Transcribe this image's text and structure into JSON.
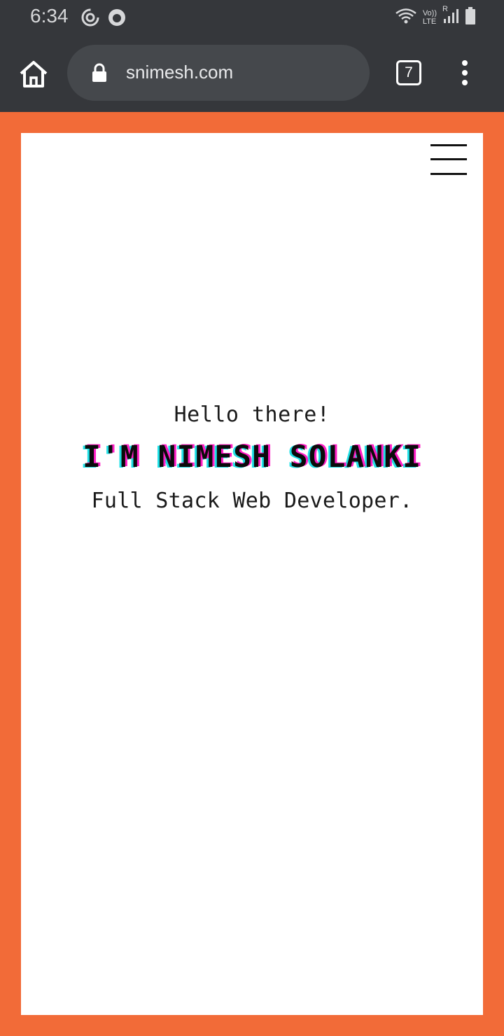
{
  "status_bar": {
    "time": "6:34",
    "network_label_top": "Vo))",
    "network_label_bottom": "LTE",
    "roaming": "R"
  },
  "browser": {
    "url": "snimesh.com",
    "tab_count": "7",
    "icons": [
      "home-icon",
      "lock-icon",
      "more-vert-icon"
    ]
  },
  "hero": {
    "greeting": "Hello there!",
    "name": "I'M NIMESH SOLANKI",
    "role": "Full Stack Web Developer."
  },
  "colors": {
    "page_border": "#f26b38",
    "browser_chrome": "#35373b",
    "glitch_cyan": "#20e0e6",
    "glitch_magenta": "#ff1fc6"
  }
}
